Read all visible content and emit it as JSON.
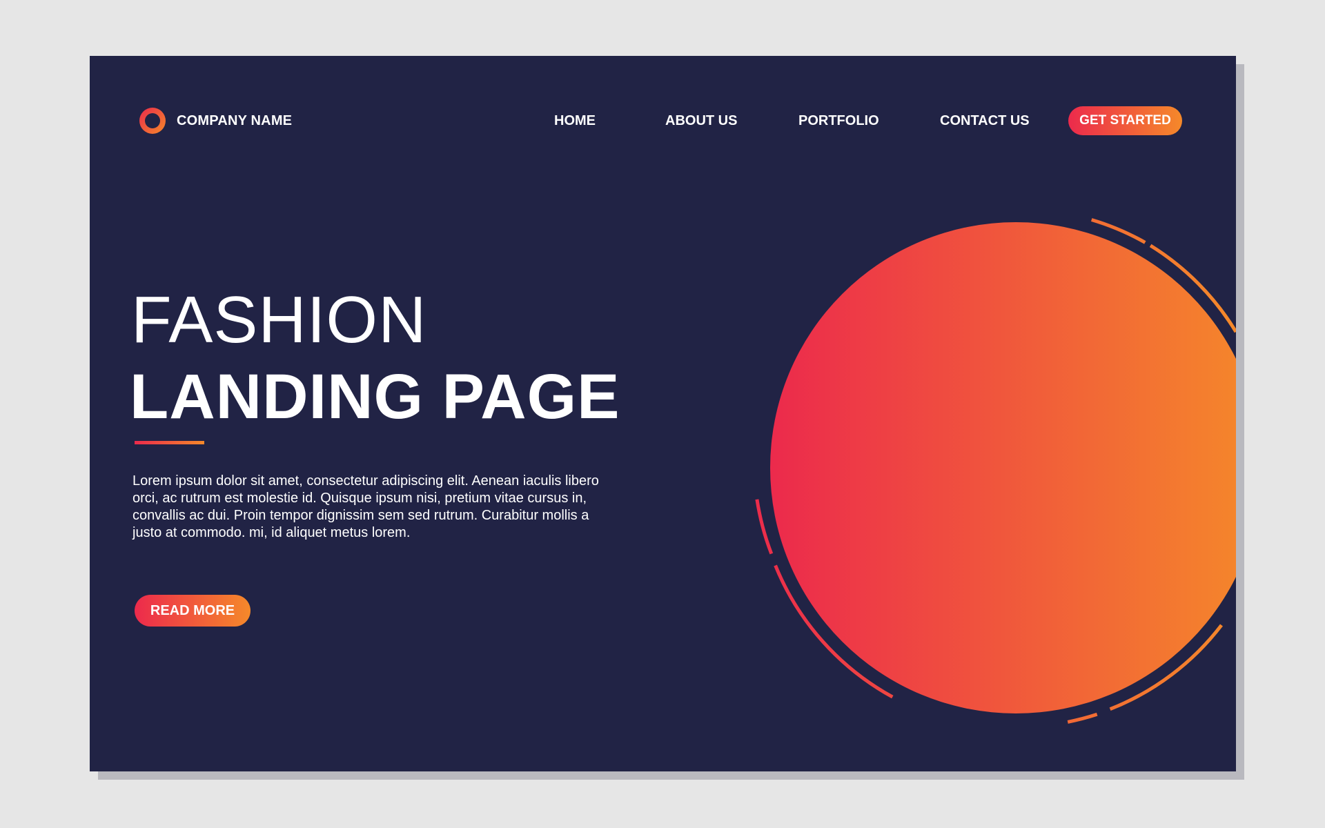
{
  "brand": {
    "name": "COMPANY NAME",
    "logo_icon": "ring-logo-icon"
  },
  "nav": {
    "items": [
      {
        "label": "HOME"
      },
      {
        "label": "ABOUT US"
      },
      {
        "label": "PORTFOLIO"
      },
      {
        "label": "CONTACT US"
      }
    ],
    "cta_label": "GET STARTED"
  },
  "hero": {
    "line1": "FASHION",
    "line2": "LANDING PAGE",
    "body": "Lorem ipsum dolor sit amet, consectetur adipiscing elit. Aenean iaculis libero orci, ac rutrum est molestie id. Quisque ipsum nisi, pretium vitae cursus in, convallis ac dui. Proin tempor dignissim sem sed rutrum. Curabitur mollis a justo at commodo. mi, id aliquet metus lorem.",
    "button_label": "READ MORE"
  },
  "colors": {
    "background": "#212345",
    "page_bg": "#e6e6e6",
    "gradient_start": "#ec2a4c",
    "gradient_end": "#f5892a",
    "text": "#ffffff"
  }
}
